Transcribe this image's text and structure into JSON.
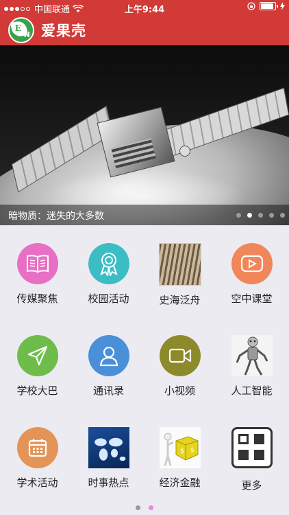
{
  "status_bar": {
    "carrier": "中国联通",
    "time": "上午9:44"
  },
  "header": {
    "app_name": "爱果壳"
  },
  "banner": {
    "caption": "暗物质：迷失的大多数",
    "slide_count": 5,
    "active_slide": 2
  },
  "grid": [
    {
      "label": "传媒聚焦",
      "icon": "open-book-icon",
      "color": "#e76fc4"
    },
    {
      "label": "校园活动",
      "icon": "award-ribbon-icon",
      "color": "#3cbdc3"
    },
    {
      "label": "史海泛舟",
      "icon": "ancient-scroll-photo"
    },
    {
      "label": "空中课堂",
      "icon": "play-screen-icon",
      "color": "#f08659"
    },
    {
      "label": "学校大巴",
      "icon": "send-arrow-icon",
      "color": "#6ebd4b"
    },
    {
      "label": "通讯录",
      "icon": "contacts-person-icon",
      "color": "#4a90d9"
    },
    {
      "label": "小视频",
      "icon": "video-camera-icon",
      "color": "#8d8a2b"
    },
    {
      "label": "人工智能",
      "icon": "robot-skeleton-photo"
    },
    {
      "label": "学术活动",
      "icon": "calendar-icon",
      "color": "#e39456"
    },
    {
      "label": "时事热点",
      "icon": "world-map-photo"
    },
    {
      "label": "经济金融",
      "icon": "money-cube-photo"
    },
    {
      "label": "更多",
      "icon": "more-grid-icon"
    }
  ],
  "pager": {
    "pages": 2,
    "active": 2
  }
}
